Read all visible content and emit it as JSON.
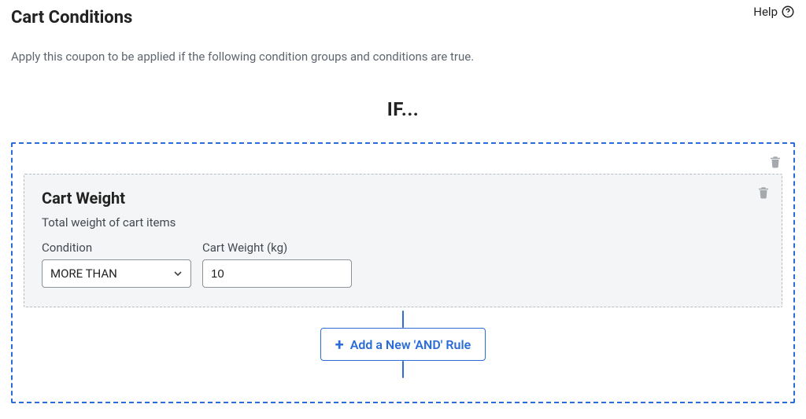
{
  "header": {
    "title": "Cart Conditions",
    "help_label": "Help"
  },
  "subtext": "Apply this coupon to be applied if the following condition groups and conditions are true.",
  "if_label": "IF...",
  "group": {
    "rule": {
      "title": "Cart Weight",
      "description": "Total weight of cart items",
      "condition_label": "Condition",
      "condition_value": "MORE THAN",
      "weight_label": "Cart Weight (kg)",
      "weight_value": "10"
    },
    "add_rule_label": "Add a New 'AND' Rule"
  }
}
